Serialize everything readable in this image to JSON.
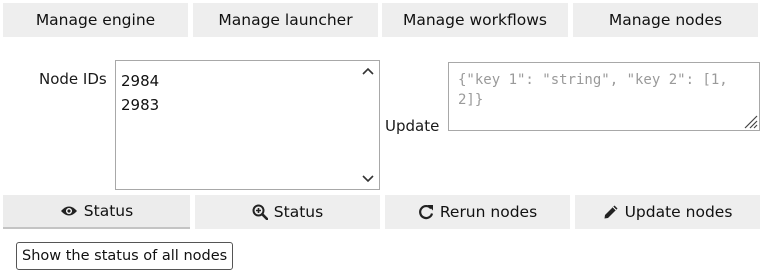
{
  "tabs": [
    {
      "label": "Manage engine"
    },
    {
      "label": "Manage launcher"
    },
    {
      "label": "Manage workflows"
    },
    {
      "label": "Manage nodes"
    }
  ],
  "node_ids": {
    "label": "Node IDs",
    "value": "2984\n2983"
  },
  "update": {
    "label": "Update",
    "placeholder": "{\"key 1\": \"string\", \"key 2\": [1, 2]}"
  },
  "actions": [
    {
      "label": "Status",
      "icon": "eye-icon"
    },
    {
      "label": "Status",
      "icon": "search-plus-icon"
    },
    {
      "label": "Rerun nodes",
      "icon": "redo-icon"
    },
    {
      "label": "Update nodes",
      "icon": "pencil-icon"
    }
  ],
  "tooltip": {
    "text": "Show the status of all nodes"
  }
}
